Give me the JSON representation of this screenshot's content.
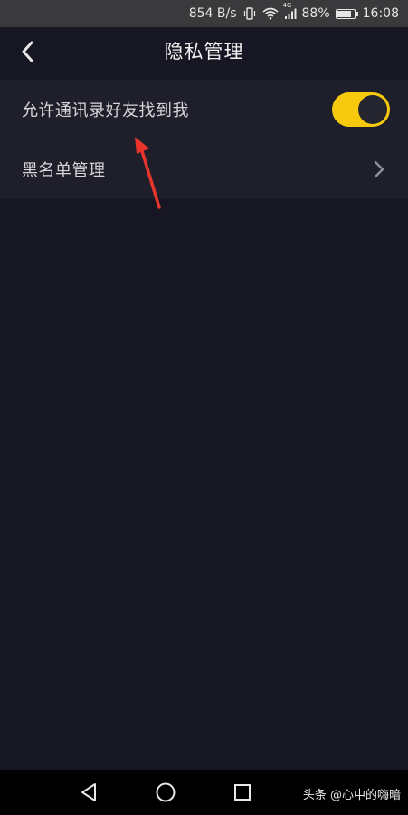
{
  "status_bar": {
    "network_speed": "854 B/s",
    "network_type": "4G",
    "battery_percent": "88%",
    "battery_level": 0.88,
    "time": "16:08",
    "icons": [
      "vibrate-icon",
      "wifi-icon",
      "signal-icon",
      "battery-icon"
    ]
  },
  "header": {
    "title": "隐私管理",
    "back_icon": "chevron-left-icon"
  },
  "settings": {
    "items": [
      {
        "label": "允许通讯录好友找到我",
        "control": "toggle",
        "enabled": true
      },
      {
        "label": "黑名单管理",
        "control": "chevron",
        "icon": "chevron-right-icon"
      }
    ]
  },
  "colors": {
    "background": "#161722",
    "list_background": "#1e1f2a",
    "toggle_on": "#f6c90e",
    "annotation": "#e8342a"
  },
  "nav_bar": {
    "icons": [
      "back-triangle-icon",
      "home-circle-icon",
      "recents-square-icon"
    ]
  },
  "watermark": "头条 @心中的嗨暗"
}
